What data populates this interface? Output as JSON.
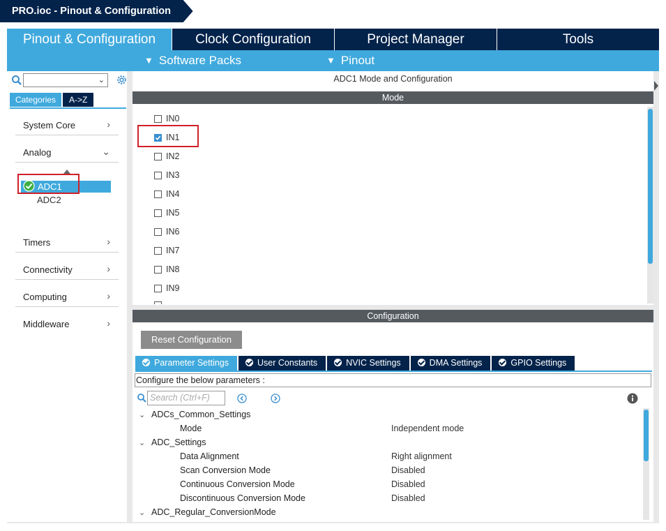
{
  "breadcrumb": {
    "file": "PRO.ioc - Pinout & Configuration"
  },
  "top_tabs": [
    {
      "label": "Pinout & Configuration",
      "active": true
    },
    {
      "label": "Clock Configuration",
      "active": false
    },
    {
      "label": "Project Manager",
      "active": false
    },
    {
      "label": "Tools",
      "active": false
    }
  ],
  "sub_tabs": [
    {
      "label": "Software Packs"
    },
    {
      "label": "Pinout"
    }
  ],
  "left": {
    "search_placeholder": "",
    "cat_tabs": [
      {
        "label": "Categories",
        "active": true
      },
      {
        "label": "A->Z",
        "active": false
      }
    ],
    "categories": [
      {
        "label": "System Core",
        "arrow": "›"
      },
      {
        "label": "Analog",
        "arrow": "⌄"
      },
      {
        "label": "Timers",
        "arrow": "›"
      },
      {
        "label": "Connectivity",
        "arrow": "›"
      },
      {
        "label": "Computing",
        "arrow": "›"
      },
      {
        "label": "Middleware",
        "arrow": "›"
      }
    ],
    "analog_items": [
      {
        "label": "ADC1",
        "selected": true
      },
      {
        "label": "ADC2",
        "selected": false
      }
    ]
  },
  "mode_panel": {
    "title": "ADC1 Mode and Configuration",
    "mode_header": "Mode",
    "inputs": [
      {
        "label": "IN0",
        "checked": false
      },
      {
        "label": "IN1",
        "checked": true
      },
      {
        "label": "IN2",
        "checked": false
      },
      {
        "label": "IN3",
        "checked": false
      },
      {
        "label": "IN4",
        "checked": false
      },
      {
        "label": "IN5",
        "checked": false
      },
      {
        "label": "IN6",
        "checked": false
      },
      {
        "label": "IN7",
        "checked": false
      },
      {
        "label": "IN8",
        "checked": false
      },
      {
        "label": "IN9",
        "checked": false
      }
    ]
  },
  "config_panel": {
    "header": "Configuration",
    "reset_label": "Reset Configuration",
    "tabs": [
      {
        "label": "Parameter Settings",
        "active": true
      },
      {
        "label": "User Constants",
        "active": false
      },
      {
        "label": "NVIC Settings",
        "active": false
      },
      {
        "label": "DMA Settings",
        "active": false
      },
      {
        "label": "GPIO Settings",
        "active": false
      }
    ],
    "configure_label": "Configure the below parameters :",
    "search_placeholder": "Search (Ctrl+F)",
    "tree": [
      {
        "group": "ADCs_Common_Settings",
        "params": [
          {
            "name": "Mode",
            "value": "Independent mode"
          }
        ]
      },
      {
        "group": "ADC_Settings",
        "params": [
          {
            "name": "Data Alignment",
            "value": "Right alignment"
          },
          {
            "name": "Scan Conversion Mode",
            "value": "Disabled"
          },
          {
            "name": "Continuous Conversion Mode",
            "value": "Disabled"
          },
          {
            "name": "Discontinuous Conversion Mode",
            "value": "Disabled"
          }
        ]
      },
      {
        "group": "ADC_Regular_ConversionMode",
        "params": []
      }
    ]
  },
  "colors": {
    "navy": "#03234b",
    "accent": "#3fa9dd",
    "highlight_box": "#d0202a"
  }
}
